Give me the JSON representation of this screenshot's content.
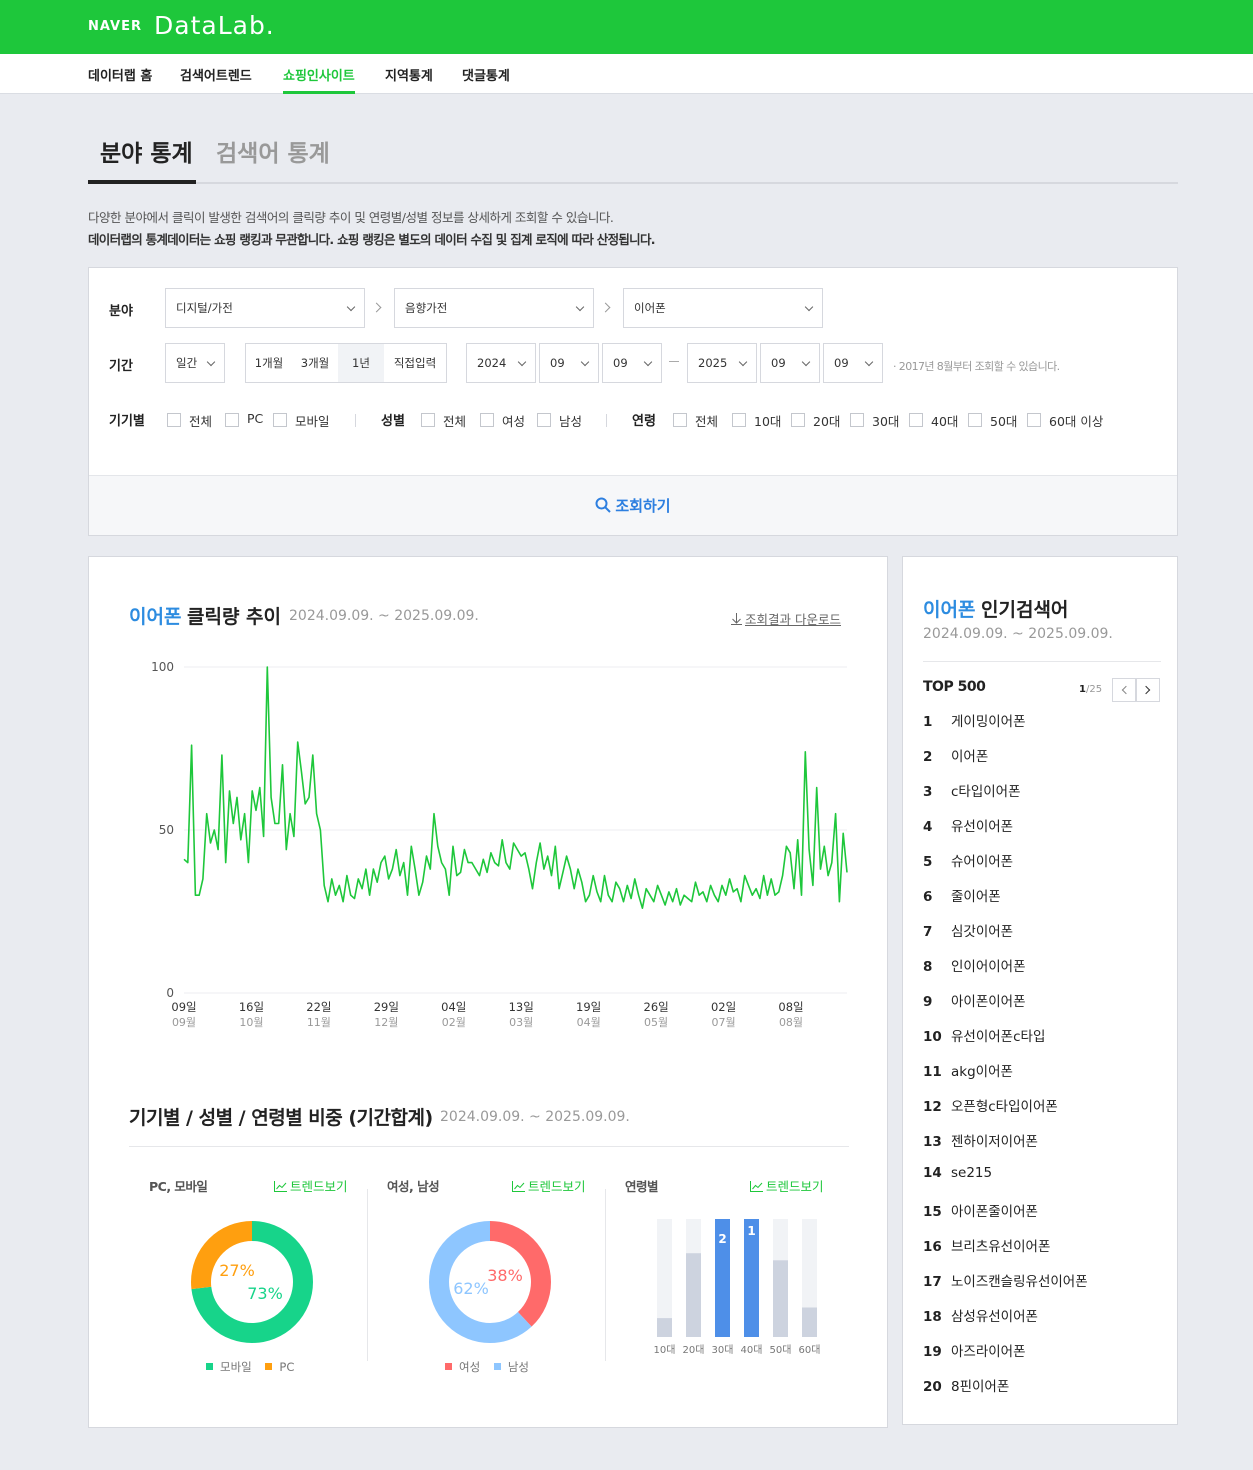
{
  "header": {
    "logo_naver": "NAVER",
    "logo_datalab": "DataLab."
  },
  "gnb": [
    "데이터랩 홈",
    "검색어트렌드",
    "쇼핑인사이트",
    "지역통계",
    "댓글통계"
  ],
  "tabs": {
    "field": "분야 통계",
    "keyword": "검색어 통계"
  },
  "desc": {
    "line1": "다양한 분야에서 클릭이 발생한 검색어의 클릭량 추이 및 연령별/성별 정보를 상세하게 조회할 수 있습니다.",
    "line2": "데이터랩의 통계데이터는 쇼핑 랭킹과 무관합니다. 쇼핑 랭킹은 별도의 데이터 수집 및 집계 로직에 따라 산정됩니다."
  },
  "filter": {
    "category_label": "분야",
    "cat1": "디지털/가전",
    "cat2": "음향가전",
    "cat3": "이어폰",
    "period_label": "기간",
    "unit": "일간",
    "seg": [
      "1개월",
      "3개월",
      "1년",
      "직접입력"
    ],
    "start_year": "2024",
    "start_month": "09",
    "start_day": "09",
    "end_year": "2025",
    "end_month": "09",
    "end_day": "09",
    "hint": "· 2017년 8월부터 조회할 수 있습니다.",
    "device_label": "기기별",
    "device_opts": [
      "전체",
      "PC",
      "모바일"
    ],
    "gender_label": "성별",
    "gender_opts": [
      "전체",
      "여성",
      "남성"
    ],
    "age_label": "연령",
    "age_opts": [
      "전체",
      "10대",
      "20대",
      "30대",
      "40대",
      "50대",
      "60대 이상"
    ],
    "search_button": "조회하기"
  },
  "trend": {
    "keyword": "이어폰",
    "title_rest": "클릭량 추이",
    "date_range": "2024.09.09. ~ 2025.09.09.",
    "download": "조회결과 다운로드"
  },
  "chart_data": [
    {
      "type": "line",
      "series": [
        {
          "values": [
            41,
            40,
            76,
            30,
            30,
            35,
            55,
            46,
            50,
            44,
            73,
            40,
            62,
            52,
            60,
            47,
            55,
            40,
            62,
            56,
            63,
            48,
            100,
            60,
            52,
            52,
            70,
            44,
            55,
            48,
            77,
            68,
            58,
            60,
            73,
            55,
            50,
            33,
            28,
            35,
            30,
            33,
            28,
            36,
            30,
            29,
            35,
            32,
            38,
            30,
            38,
            34,
            40,
            42,
            35,
            38,
            44,
            36,
            40,
            30,
            45,
            38,
            30,
            34,
            42,
            38,
            55,
            45,
            40,
            38,
            30,
            45,
            36,
            37,
            44,
            40,
            40,
            38,
            36,
            41,
            37,
            43,
            40,
            39,
            47,
            40,
            38,
            46,
            44,
            42,
            43,
            38,
            32,
            40,
            46,
            38,
            42,
            36,
            45,
            32,
            37,
            42,
            38,
            32,
            38,
            34,
            28,
            30,
            36,
            31,
            28,
            36,
            30,
            28,
            34,
            32,
            28,
            33,
            29,
            35,
            30,
            26,
            32,
            30,
            28,
            33,
            30,
            27,
            31,
            28,
            32,
            27,
            30,
            29,
            28,
            34,
            30,
            31,
            28,
            33,
            30,
            28,
            33,
            30,
            35,
            31,
            32,
            28,
            36,
            33,
            30,
            32,
            29,
            36,
            30,
            35,
            30,
            31,
            36,
            45,
            43,
            32,
            47,
            30,
            74,
            44,
            33,
            63,
            38,
            45,
            36,
            40,
            55,
            28,
            49,
            37
          ]
        }
      ],
      "categories": [
        "09일",
        "16일",
        "22일",
        "29일",
        "04일",
        "13일",
        "19일",
        "26일",
        "02일",
        "08일"
      ],
      "x_sublabels": [
        "09월",
        "10월",
        "11월",
        "12월",
        "02월",
        "03월",
        "04월",
        "05월",
        "07월",
        "08월"
      ],
      "yticks": [
        "100",
        "50",
        "0"
      ],
      "ylim": [
        0,
        100
      ],
      "grid": true
    },
    {
      "type": "pie",
      "categories": [
        "모바일",
        "PC"
      ],
      "values": [
        73,
        27
      ],
      "labels": [
        "73%",
        "27%"
      ]
    },
    {
      "type": "pie",
      "categories": [
        "여성",
        "남성"
      ],
      "values": [
        38,
        62
      ],
      "labels": [
        "38%",
        "62%"
      ]
    },
    {
      "type": "bar",
      "categories": [
        "10대",
        "20대",
        "30대",
        "40대",
        "50대",
        "60대"
      ],
      "values": [
        16,
        71,
        100,
        100,
        65,
        25
      ],
      "rank_labels": [
        "",
        "",
        "2",
        "1",
        "",
        ""
      ],
      "ylim": [
        0,
        100
      ]
    }
  ],
  "ratio": {
    "title": "기기별 / 성별 / 연령별 비중 (기간합계)",
    "date_range": "2024.09.09. ~ 2025.09.09.",
    "device_title": "PC, 모바일",
    "gender_title": "여성, 남성",
    "age_title": "연령별",
    "trend_link": "트렌드보기"
  },
  "colors": {
    "brand_green": "#1ec73b",
    "mobile": "#17d48a",
    "pc": "#ff9f0f",
    "female": "#ff6a6a",
    "male": "#8ec6ff",
    "age_top": "#4e8fe8",
    "age_other": "#cdd3df"
  },
  "side": {
    "keyword": "이어폰",
    "title_rest": "인기검색어",
    "date_range": "2024.09.09. ~ 2025.09.09.",
    "top": "TOP 500",
    "page_cur": "1",
    "page_total": "/25",
    "ranks": [
      "게이밍이어폰",
      "이어폰",
      "c타입이어폰",
      "유선이어폰",
      "슈어이어폰",
      "줄이어폰",
      "심갓이어폰",
      "인이어이어폰",
      "아이폰이어폰",
      "유선이어폰c타입",
      "akg이어폰",
      "오픈형c타입이어폰",
      "젠하이저이어폰",
      "se215",
      "아이폰줄이어폰",
      "브리츠유선이어폰",
      "노이즈캔슬링유선이어폰",
      "삼성유선이어폰",
      "아즈라이어폰",
      "8핀이어폰"
    ]
  }
}
